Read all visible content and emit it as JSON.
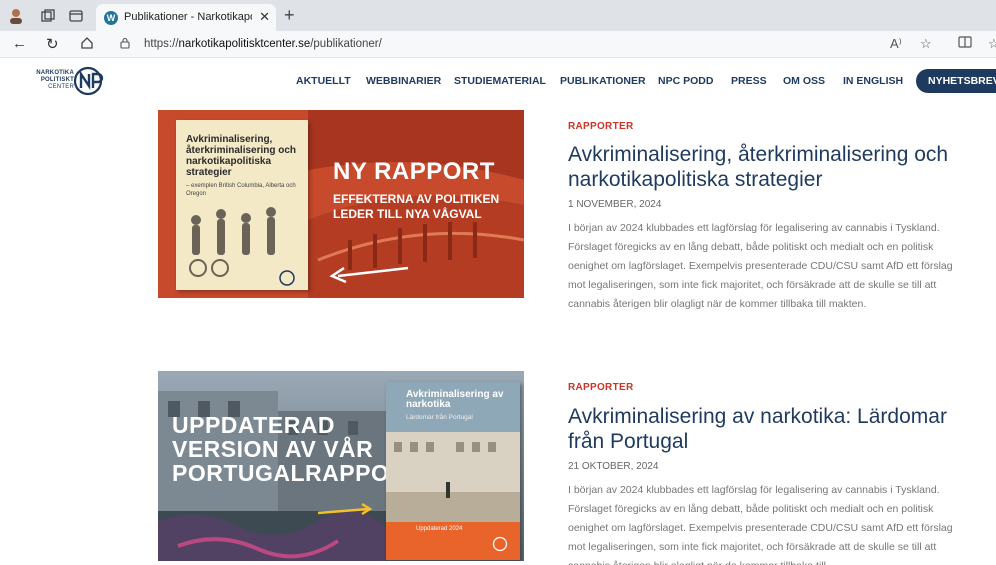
{
  "browser": {
    "tab_title": "Publikationer - Narkotikapolitiskt",
    "tab_close": "✕",
    "new_tab": "+",
    "url_scheme": "https://",
    "url_host": "narkotikapolitisktcenter.se",
    "url_path": "/publikationer/",
    "read_aloud": "A⁾"
  },
  "site": {
    "logo_line1": "NARKOTIKA",
    "logo_line2": "POLITISKT",
    "logo_line3": "CENTER",
    "nav": [
      "AKTUELLT",
      "WEBBINARIER",
      "STUDIEMATERIAL",
      "PUBLIKATIONER",
      "NPC PODD",
      "PRESS",
      "OM OSS",
      "IN ENGLISH"
    ],
    "newsletter": "NYHETSBREV"
  },
  "articles": [
    {
      "category": "RAPPORTER",
      "title": "Avkriminalisering, återkriminalisering och narkotikapolitiska strategier",
      "date": "1 NOVEMBER, 2024",
      "excerpt": "I början av 2024 klubbades ett lagförslag för legalisering av cannabis i Tyskland. Förslaget föregicks av en lång debatt, både politiskt och medialt och en politisk oenighet om lagförslaget. Exempelvis presenterade CDU/CSU samt AfD ett förslag mot legaliseringen, som inte fick majoritet, och försäkrade att de skulle se till att cannabis återigen blir olagligt när de kommer tillbaka till makten.",
      "image": {
        "book_title": "Avkriminalisering, återkriminalisering och narkotikapolitiska strategier",
        "book_sub": "– exemplen British Columbia, Alberta och Oregon",
        "headline": "NY RAPPORT",
        "subline1": "EFFEKTERNA AV POLITIKEN",
        "subline2": "LEDER TILL NYA VÅGVAL"
      }
    },
    {
      "category": "RAPPORTER",
      "title": "Avkriminalisering av narkotika: Lärdomar från Portugal",
      "date": "21 OKTOBER, 2024",
      "excerpt": "I början av 2024 klubbades ett lagförslag för legalisering av cannabis i Tyskland. Förslaget föregicks av en lång debatt, både politiskt och medialt och en politisk oenighet om lagförslaget. Exempelvis presenterade CDU/CSU samt AfD ett förslag mot legaliseringen, som inte fick majoritet, och försäkrade att de skulle se till att cannabis återigen blir olagligt när de kommer tillbaka till",
      "image": {
        "headline1": "UPPDATERAD",
        "headline2": "VERSION AV VÅR",
        "headline3": "PORTUGALRAPPORT",
        "book_title": "Avkriminalisering av narkotika",
        "book_sub": "Lärdomar från Portugal",
        "book_edition": "Uppdaterad 2024"
      }
    }
  ],
  "colors": {
    "brand_navy": "#1f3a5f",
    "category_red": "#c8352a",
    "banner_orange": "#c84a2c"
  }
}
